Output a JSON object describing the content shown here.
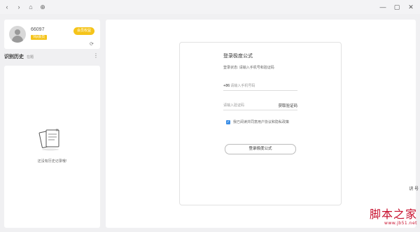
{
  "titlebar": {
    "back": "‹",
    "forward": "›",
    "home": "⌂",
    "refresh": "⊕",
    "minimize": "—",
    "maximize": "▢",
    "close": "✕"
  },
  "user": {
    "id": "66097",
    "vip_badge": "Vip会员",
    "open_member": "会员权益"
  },
  "history": {
    "title": "识别历史",
    "subtitle": "在题",
    "empty_text": "还没有历史记录哦!"
  },
  "login": {
    "title": "登录极度公式",
    "subtitle": "登录状态: 请输入手机号和验证码",
    "phone_prefix": "+86",
    "phone_placeholder": "请输入手机号码",
    "code_placeholder": "请输入验证码",
    "get_code": "获取验证码",
    "agreement": "我已阅读并同意用户协议和隐私政策",
    "button": "登录极度公式"
  },
  "side_mark": "识  号",
  "watermark": {
    "text": "脚本之家",
    "url": "www.jb51.net"
  },
  "colors": {
    "accent_yellow": "#f5c41a",
    "checkbox_blue": "#3b8ee6",
    "watermark_red": "#c8102e"
  }
}
